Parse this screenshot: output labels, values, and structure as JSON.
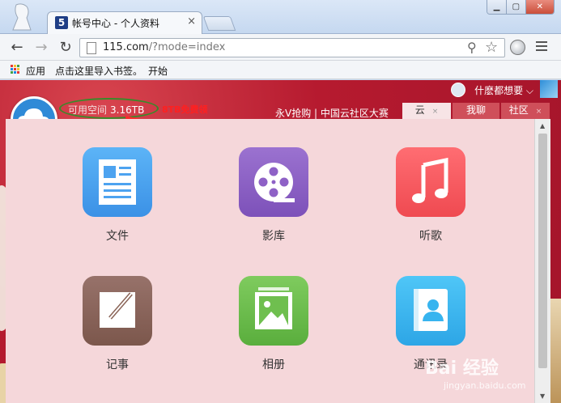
{
  "browser": {
    "tab_title": "帐号中心 - 个人资料",
    "tab_favicon": "5",
    "url_host": "115.com",
    "url_rest": "/?mode=index"
  },
  "bookmarks": {
    "items": [
      "应用",
      "点击这里导入书签。",
      "开始"
    ]
  },
  "page": {
    "user_name": "什麽都想要",
    "space_label": "可用空间",
    "space_value": "3.16TB",
    "promo": "8TB免费领",
    "ad_text": "永V抢购 | 中国云社区大赛",
    "tabs": [
      {
        "label": "云",
        "active": true
      },
      {
        "label": "我聊",
        "active": false
      },
      {
        "label": "社区",
        "active": false
      }
    ],
    "apps": [
      {
        "label": "文件"
      },
      {
        "label": "影库"
      },
      {
        "label": "听歌"
      },
      {
        "label": "记事"
      },
      {
        "label": "相册"
      },
      {
        "label": "通讯录"
      }
    ],
    "watermark": "Bai 经验",
    "watermark_url": "jingyan.baidu.com"
  },
  "colors": {
    "files": "#4da3f0",
    "movies": "#8e61c6",
    "music": "#f4585f",
    "notes": "#8a6457",
    "photos": "#6fbf4f",
    "contacts": "#37b4ef"
  }
}
